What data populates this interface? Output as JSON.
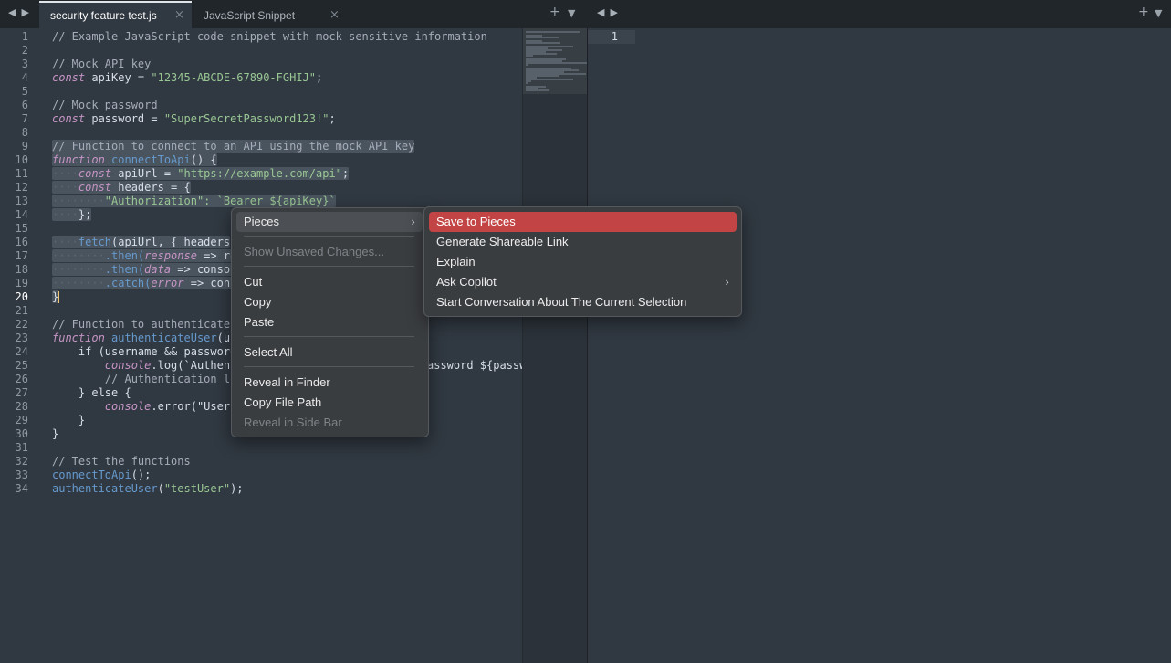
{
  "tabs": [
    {
      "label": "security feature test.js",
      "active": true
    },
    {
      "label": "JavaScript Snippet",
      "active": false
    }
  ],
  "controls": {
    "nav_back": "◀",
    "nav_forward": "▶",
    "add": "+",
    "dropdown": "▼",
    "close": "×"
  },
  "editor": {
    "current_line": 20,
    "lines": [
      {
        "n": "1"
      },
      {
        "n": "2"
      },
      {
        "n": "3"
      },
      {
        "n": "4"
      },
      {
        "n": "5"
      },
      {
        "n": "6"
      },
      {
        "n": "7"
      },
      {
        "n": "8"
      },
      {
        "n": "9"
      },
      {
        "n": "10"
      },
      {
        "n": "11"
      },
      {
        "n": "12"
      },
      {
        "n": "13"
      },
      {
        "n": "14"
      },
      {
        "n": "15"
      },
      {
        "n": "16"
      },
      {
        "n": "17"
      },
      {
        "n": "18"
      },
      {
        "n": "19"
      },
      {
        "n": "20"
      },
      {
        "n": "21"
      },
      {
        "n": "22"
      },
      {
        "n": "23"
      },
      {
        "n": "24"
      },
      {
        "n": "25"
      },
      {
        "n": "26"
      },
      {
        "n": "27"
      },
      {
        "n": "28"
      },
      {
        "n": "29"
      },
      {
        "n": "30"
      },
      {
        "n": "31"
      },
      {
        "n": "32"
      },
      {
        "n": "33"
      },
      {
        "n": "34"
      }
    ],
    "code": {
      "l1": "// Example JavaScript code snippet with mock sensitive information",
      "l3": "// Mock API key",
      "l4_kw": "const",
      "l4_rest": " apiKey = ",
      "l4_str": "\"12345-ABCDE-67890-FGHIJ\"",
      "l4_end": ";",
      "l6": "// Mock password",
      "l7_kw": "const",
      "l7_rest": " password = ",
      "l7_str": "\"SuperSecretPassword123!\"",
      "l7_end": ";",
      "l9": "// Function to connect to an API using the mock API key",
      "l10_kw": "function",
      "l10_fn": " connectToApi",
      "l10_rest": "() {",
      "l11_ws": "····",
      "l11_kw": "const",
      "l11_rest": " apiUrl = ",
      "l11_str": "\"https://example.com/api\"",
      "l11_end": ";",
      "l12_ws": "····",
      "l12_kw": "const",
      "l12_rest": " headers = {",
      "l13_ws": "········",
      "l13_str": "\"Authorization\"",
      "l13_rest": ": `Bearer ${apiKey}`",
      "l14_ws": "····",
      "l14_rest": "};",
      "l16_ws": "····",
      "l16_fn": "fetch",
      "l16_rest": "(apiUrl, { headers",
      "l17_ws": "········",
      "l17_rest": ".then(",
      "l17_arg": "response",
      "l17_arrow": " => re",
      "l18_ws": "········",
      "l18_rest": ".then(",
      "l18_arg": "data",
      "l18_arrow": " => consol",
      "l19_ws": "········",
      "l19_rest": ".catch(",
      "l19_arg": "error",
      "l19_arrow": " => cons",
      "l20": "}",
      "l22": "// Function to authenticate",
      "l23_kw": "function",
      "l23_fn": " authenticateUser",
      "l23_rest": "(us",
      "l24": "    if (username && password",
      "l25_pre": "        ",
      "l25_fn": "console",
      "l25_rest": ".log(`Authent",
      "l25_tail": "assword ${passw",
      "l26": "        // Authentication lo",
      "l27": "    } else {",
      "l28_pre": "        ",
      "l28_fn": "console",
      "l28_rest": ".error(\"Usern",
      "l29": "    }",
      "l30": "}",
      "l32": "// Test the functions",
      "l33_fn": "connectToApi",
      "l33_rest": "();",
      "l34_fn": "authenticateUser",
      "l34_rest": "(",
      "l34_str": "\"testUser\"",
      "l34_end": ");"
    }
  },
  "pane2": {
    "line_number": "1"
  },
  "context_menu": {
    "items": [
      "Pieces",
      "Show Unsaved Changes...",
      "Cut",
      "Copy",
      "Paste",
      "Select All",
      "Reveal in Finder",
      "Copy File Path",
      "Reveal in Side Bar"
    ],
    "submenu_arrow": "›"
  },
  "pieces_submenu": {
    "items": [
      "Save to Pieces",
      "Generate Shareable Link",
      "Explain",
      "Ask Copilot",
      "Start Conversation About The Current Selection"
    ]
  },
  "colors": {
    "highlight": "#c24444",
    "background": "#303841",
    "comment": "#a6acb9",
    "keyword": "#c594c5",
    "string": "#99c794",
    "function": "#6699cc"
  }
}
